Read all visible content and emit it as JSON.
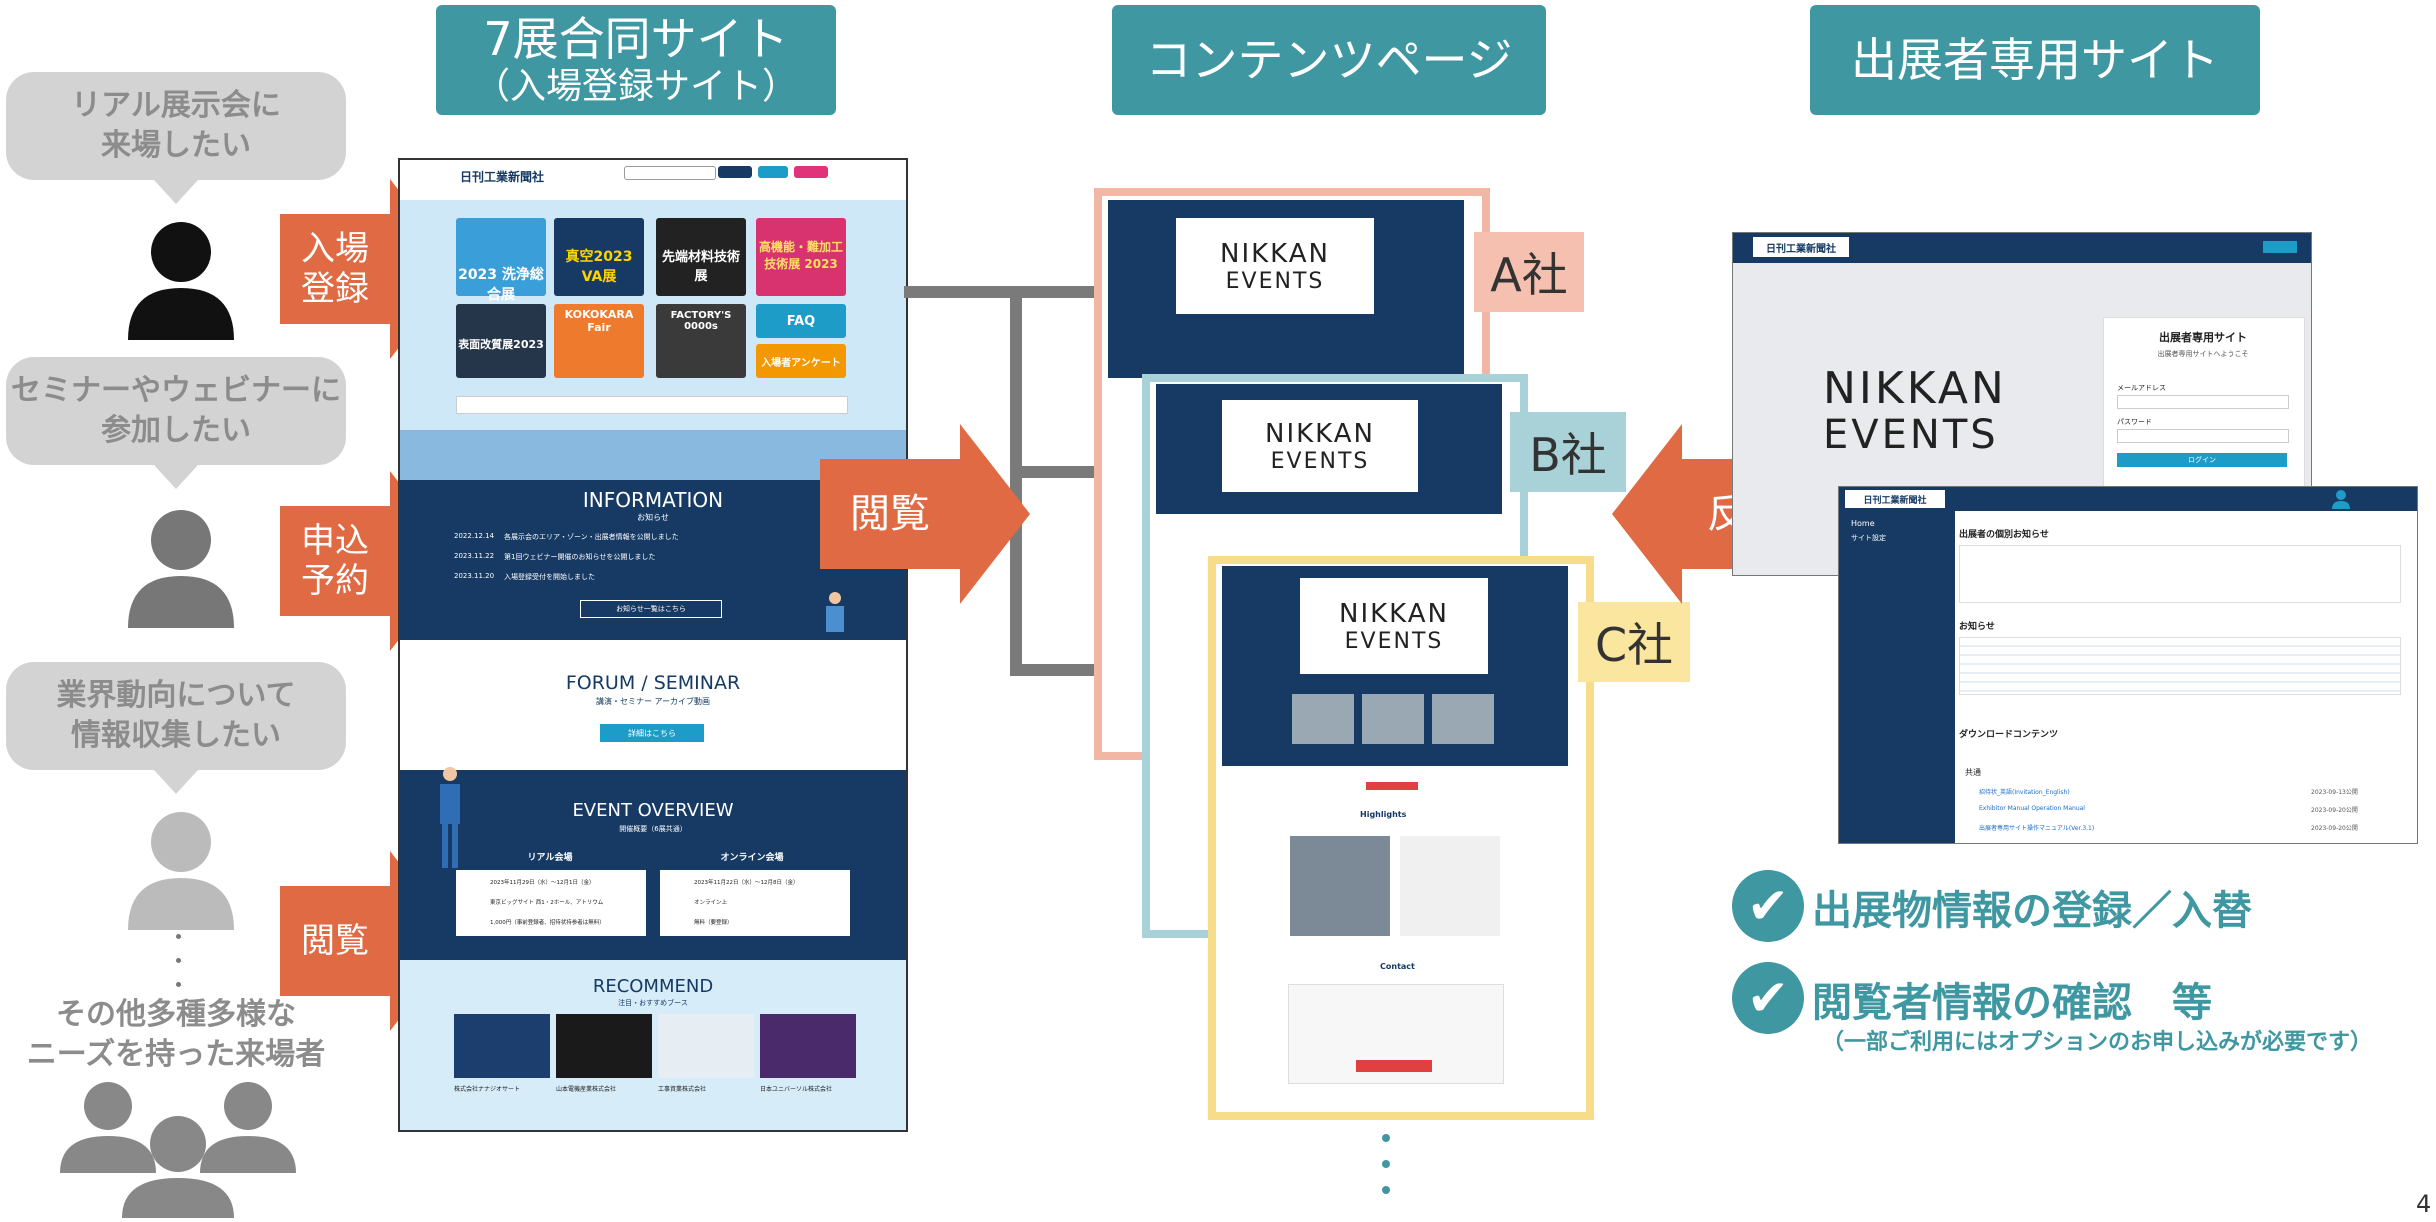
{
  "headers": {
    "joint_site_line1": "7展合同サイト",
    "joint_site_line2": "（入場登録サイト）",
    "contents_page": "コンテンツページ",
    "exhibitor_site": "出展者専用サイト"
  },
  "needs": [
    {
      "text": "リアル展示会に\n来場したい"
    },
    {
      "text": "セミナーやウェビナーに\n参加したい"
    },
    {
      "text": "業界動向について\n情報収集したい"
    },
    {
      "text": "その他多種多様な\nニーズを持った来場者"
    }
  ],
  "arrows": {
    "register": "入場\n登録",
    "reserve": "申込\n予約",
    "browse_left": "閲覧",
    "browse_center": "閲覧",
    "reflect": "反映"
  },
  "joint_site": {
    "logo": "日刊工業新聞社",
    "sections": {
      "information_title": "INFORMATION",
      "information_sub": "お知らせ",
      "info_items": [
        {
          "date": "2022.12.14",
          "text": "各展示会のエリア・ゾーン・出展者情報を公開しました"
        },
        {
          "date": "2023.11.22",
          "text": "第1回ウェビナー開催のお知らせを公開しました"
        },
        {
          "date": "2023.11.20",
          "text": "入場登録受付を開始しました"
        }
      ],
      "info_more": "お知らせ一覧はこちら",
      "forum_title": "FORUM / SEMINAR",
      "forum_sub": "講演・セミナー アーカイブ動画",
      "forum_btn": "詳細はこちら",
      "overview_title": "EVENT OVERVIEW",
      "overview_sub": "開催概要（6展共通）",
      "real_venue": "リアル会場",
      "online_venue": "オンライン会場",
      "real_rows": [
        "2023年11月29日（水）～12月1日（金）",
        "東京ビッグサイト 西1・2ホール、アトリウム",
        "1,000円（事前登録者、招待状持参者は無料）"
      ],
      "online_rows": [
        "2023年11月22日（水）～12月8日（金）",
        "オンライン上",
        "無料（要登録）"
      ],
      "recommend_title": "RECOMMEND",
      "recommend_sub": "注目・おすすめブース",
      "recommend_items": [
        "株式会社ナナジオサート",
        "山本電機産業株式会社",
        "工事資業株式会社",
        "日本ユニバーソル株式会社"
      ],
      "faq": "FAQ",
      "survey": "入場者アンケート",
      "expo_tiles": [
        "2023 洗浄総合展",
        "真空2023 VA展",
        "先端材料技術展",
        "高機能・難加工技術展 2023",
        "表面改質展2023",
        "KOKOKARA Fair",
        "FACTORY'S 0000s"
      ]
    }
  },
  "contents": {
    "logo_line1": "NIKKAN",
    "logo_line2": "EVENTS",
    "companies": [
      "A社",
      "B社",
      "C社"
    ],
    "highlights": "Highlights",
    "contact": "Contact"
  },
  "exhibitor": {
    "logo": "日刊工業新聞社",
    "login_title": "出展者専用サイト",
    "login_desc": "出展者専用サイトへようこそ",
    "email_label": "メールアドレス",
    "password_label": "パスワード",
    "login_btn": "ログイン",
    "brand_line1": "NIKKAN",
    "brand_line2": "EVENTS",
    "dash_menu_home": "Home",
    "dash_menu_settings": "サイト設定",
    "dash_notice_title": "出展者の個別お知らせ",
    "dash_news_title": "お知らせ",
    "dash_download_title": "ダウンロードコンテンツ",
    "dash_common": "共通",
    "downloads": [
      {
        "name": "招待状_英語(Invitation_English)",
        "date": "2023-09-13公開"
      },
      {
        "name": "Exhibitor Manual Operation Manual",
        "date": "2023-09-20公開"
      },
      {
        "name": "出展者専用サイト操作マニュアル(Ver.3.1)",
        "date": "2023-09-20公開"
      }
    ]
  },
  "features": [
    {
      "text": "出展物情報の登録／入替"
    },
    {
      "text": "閲覧者情報の確認　等"
    }
  ],
  "feature_note": "（一部ご利用にはオプションのお申し込みが必要です）",
  "page_number": "4",
  "colors": {
    "teal": "#3f97a2",
    "orange": "#e06a43",
    "navy": "#163a63",
    "gray_bubble": "#d3d3d3"
  }
}
